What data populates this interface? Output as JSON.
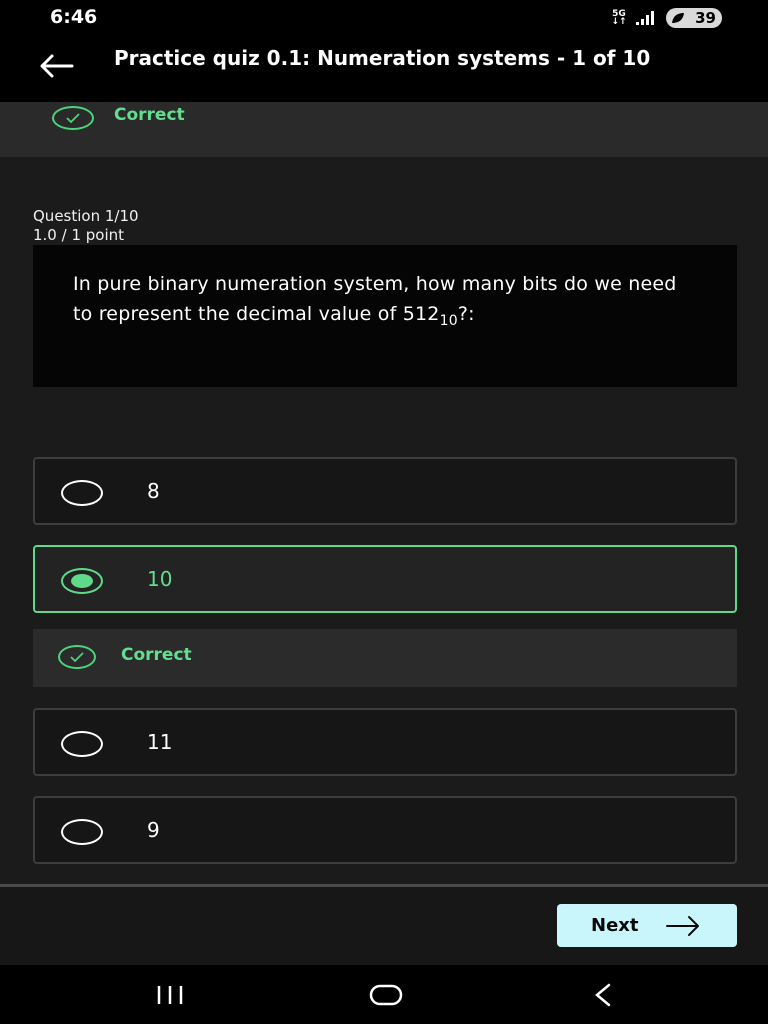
{
  "status_bar": {
    "time": "6:46",
    "network": "5G",
    "battery": "39"
  },
  "header": {
    "title": "Practice quiz 0.1: Numeration systems - 1 of 10",
    "back_icon": "arrow-left-icon"
  },
  "top_banner": {
    "label": "Correct",
    "icon": "check-circle-icon"
  },
  "question": {
    "number": "Question 1/10",
    "points": "1.0 / 1 point",
    "text": "In pure binary numeration system, how many bits do we need to represent the decimal value of ",
    "value": "512",
    "subscript": "10",
    "suffix": "?:"
  },
  "options": [
    {
      "label": "8",
      "selected": false
    },
    {
      "label": "10",
      "selected": true
    },
    {
      "label": "11",
      "selected": false
    },
    {
      "label": "9",
      "selected": false
    }
  ],
  "feedback": {
    "label": "Correct",
    "icon": "check-circle-icon"
  },
  "footer": {
    "next_label": "Next",
    "next_icon": "arrow-right-icon"
  },
  "colors": {
    "correct": "#63de8e",
    "next_button": "#c8f6fb",
    "background": "#1b1b1b"
  }
}
